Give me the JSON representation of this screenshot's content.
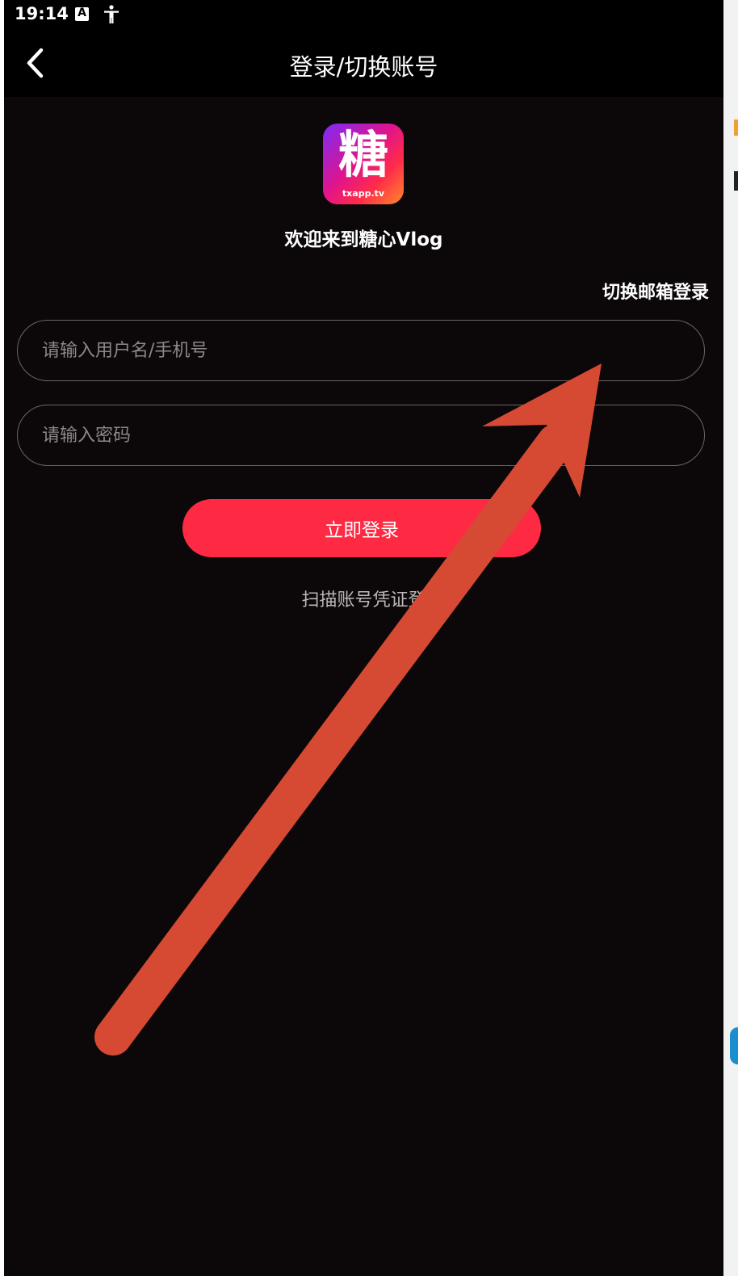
{
  "status_bar": {
    "time": "19:14",
    "icons": [
      "a-notification-icon",
      "accessibility-icon"
    ]
  },
  "app_bar": {
    "title": "登录/切换账号",
    "back_icon": "chevron-left-icon"
  },
  "logo": {
    "character": "糖",
    "url_text": "txapp.tv"
  },
  "welcome_text": "欢迎来到糖心Vlog",
  "switch_email_label": "切换邮箱登录",
  "form": {
    "username": {
      "value": "",
      "placeholder": "请输入用户名/手机号"
    },
    "password": {
      "value": "",
      "placeholder": "请输入密码"
    }
  },
  "login_button_label": "立即登录",
  "scan_link_label": "扫描账号凭证登",
  "colors": {
    "background": "#0c080a",
    "accent": "#fe2a43",
    "annotation_arrow": "#d64a33"
  },
  "annotation": {
    "type": "arrow",
    "icon": "annotation-arrow-icon"
  }
}
